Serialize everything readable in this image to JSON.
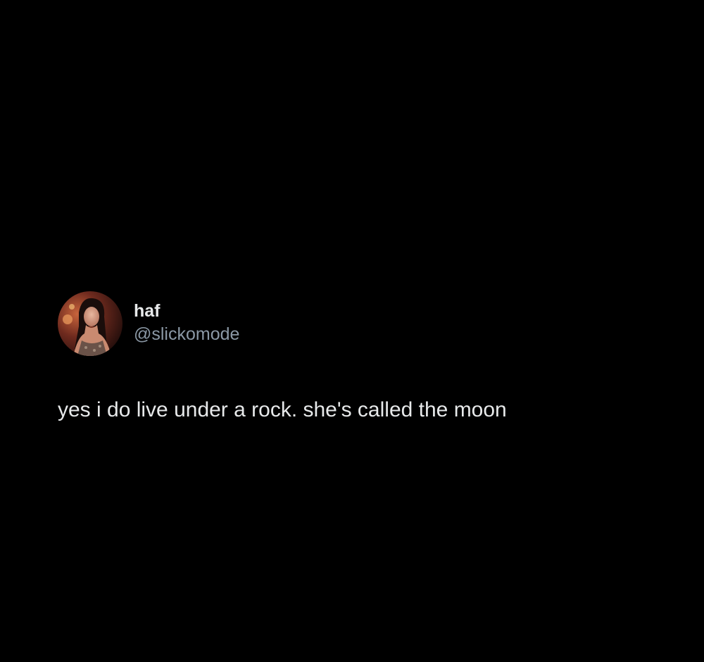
{
  "tweet": {
    "author": {
      "display_name": "haf",
      "handle": "@slickomode",
      "avatar": "profile-photo"
    },
    "text": "yes i do live under a rock. she's called the moon"
  },
  "colors": {
    "background": "#000000",
    "primary_text": "#e7e9ea",
    "secondary_text": "#8b98a5"
  }
}
